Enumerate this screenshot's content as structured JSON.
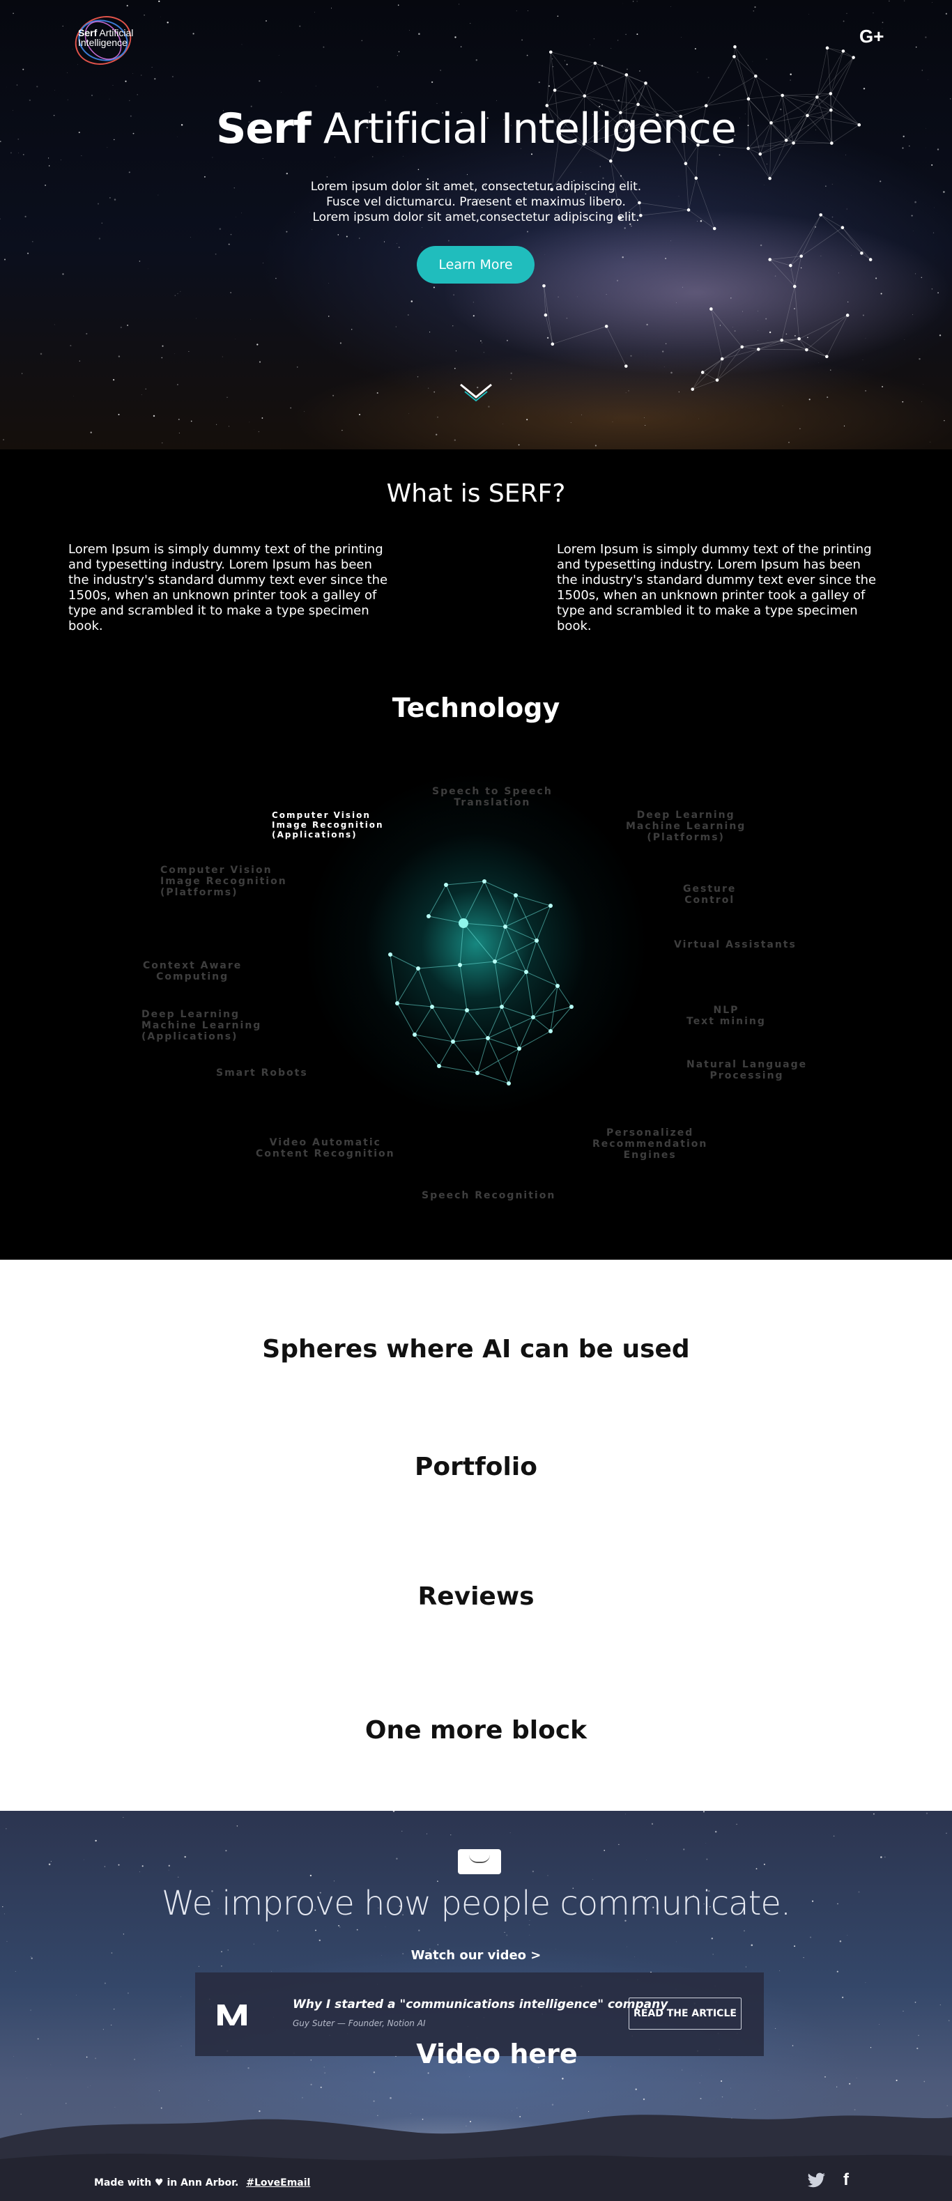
{
  "header": {
    "logo": {
      "bold": "Serf",
      "line1_rest": "Artificial",
      "line2": "Intelligence"
    },
    "social": {
      "gplus_label": "G+"
    }
  },
  "hero": {
    "title_bold": "Serf",
    "title_rest": "Artificial Intelligence",
    "lead": [
      "Lorem ipsum dolor sit amet, consectetur adipiscing elit.",
      "Fusce vel dictumarcu. Praesent et maximus libero.",
      "Lorem ipsum dolor sit amet,consectetur adipiscing elit."
    ],
    "cta_label": "Learn More"
  },
  "what": {
    "title": "What is SERF?",
    "col_left": "Lorem Ipsum is simply dummy text of the printing and typesetting industry. Lorem Ipsum has been the industry's standard dummy text ever since the 1500s, when an unknown printer took a galley of type and scrambled it to make a type specimen book.",
    "col_right": "Lorem Ipsum is simply dummy text of the printing and typesetting industry. Lorem Ipsum has been the industry's standard dummy text ever since the 1500s, when an unknown printer took a galley of type and scrambled it to make a type specimen book."
  },
  "technology": {
    "title": "Technology",
    "labels": [
      {
        "text": "Speech to Speech\nTranslation",
        "active": false
      },
      {
        "text": "Computer Vision\nImage Recognition\n(Applications)",
        "active": true
      },
      {
        "text": "Deep Learning\nMachine Learning\n(Platforms)",
        "active": false
      },
      {
        "text": "Computer Vision\nImage Recognition\n(Platforms)",
        "active": false
      },
      {
        "text": "Gesture\nControl",
        "active": false
      },
      {
        "text": "Virtual Assistants",
        "active": false
      },
      {
        "text": "Context Aware\nComputing",
        "active": false
      },
      {
        "text": "Deep Learning\nMachine Learning\n(Applications)",
        "active": false
      },
      {
        "text": "NLP\nText mining",
        "active": false
      },
      {
        "text": "Smart Robots",
        "active": false
      },
      {
        "text": "Natural Language\nProcessing",
        "active": false
      },
      {
        "text": "Video Automatic\nContent Recognition",
        "active": false
      },
      {
        "text": "Personalized\nRecommendation\nEngines",
        "active": false
      },
      {
        "text": "Speech Recognition",
        "active": false
      }
    ]
  },
  "blocks": {
    "spheres": "Spheres where AI can be used",
    "portfolio": "Portfolio",
    "reviews": "Reviews",
    "more": "One more block"
  },
  "footer": {
    "title": "We improve how people communicate.",
    "watch": "Watch our video >",
    "article": {
      "title": "Why I started a \"communications intelligence\" company",
      "subtitle": "Guy Suter — Founder, Notion AI",
      "button": "READ THE ARTICLE"
    },
    "video_placeholder": "Video here",
    "made_with": "Made with ♥ in Ann Arbor.",
    "hashtag": "#LoveEmail",
    "icons": [
      "twitter-icon",
      "facebook-icon"
    ]
  },
  "colors": {
    "accent": "#20bdbd",
    "tech_active": "#ffffff",
    "tech_inactive": "#3e3e3e",
    "glow": "#1eb4aa"
  }
}
